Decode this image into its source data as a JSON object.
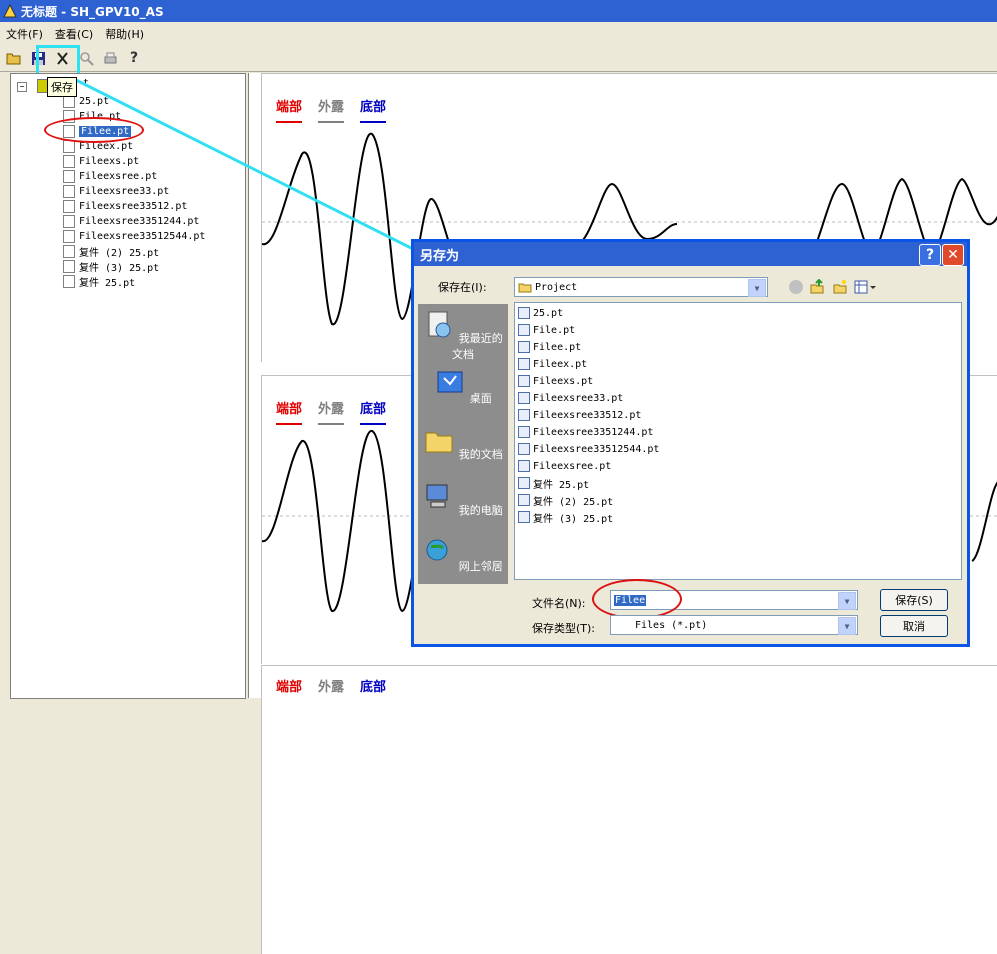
{
  "window": {
    "title": "无标题 - SH_GPV10_AS"
  },
  "menu": [
    "文件(F)",
    "查看(C)",
    "帮助(H)"
  ],
  "toolbar": {
    "tooltip": "保存"
  },
  "tree": {
    "root_suffix": "t",
    "items": [
      "25.pt",
      "File.pt",
      "Filee.pt",
      "Fileex.pt",
      "Fileexs.pt",
      "Fileexsree.pt",
      "Fileexsree33.pt",
      "Fileexsree33512.pt",
      "Fileexsree3351244.pt",
      "Fileexsree33512544.pt",
      "复件 (2) 25.pt",
      "复件 (3) 25.pt",
      "复件 25.pt"
    ],
    "selected_index": 2
  },
  "legend": {
    "a": "端部",
    "b": "外露",
    "c": "底部"
  },
  "colors": {
    "red": "#e00000",
    "gray": "#808080",
    "blue": "#0000c0",
    "xp_blue": "#2e62d2",
    "cyan": "#2fe0f0"
  },
  "dialog": {
    "title": "另存为",
    "lookin_label": "保存在(I):",
    "lookin_value": "Project",
    "places": [
      "我最近的文档",
      "桌面",
      "我的文档",
      "我的电脑",
      "网上邻居"
    ],
    "files": [
      "25.pt",
      "File.pt",
      "Filee.pt",
      "Fileex.pt",
      "Fileexs.pt",
      "Fileexsree33.pt",
      "Fileexsree33512.pt",
      "Fileexsree3351244.pt",
      "Fileexsree33512544.pt",
      "Fileexsree.pt",
      "复件 25.pt",
      "复件 (2) 25.pt",
      "复件 (3) 25.pt"
    ],
    "filename_label": "文件名(N):",
    "filename_value": "Filee",
    "filetype_label": "保存类型(T):",
    "filetype_value": "Files (*.pt)",
    "save_button": "保存(S)",
    "cancel_button": "取消"
  }
}
